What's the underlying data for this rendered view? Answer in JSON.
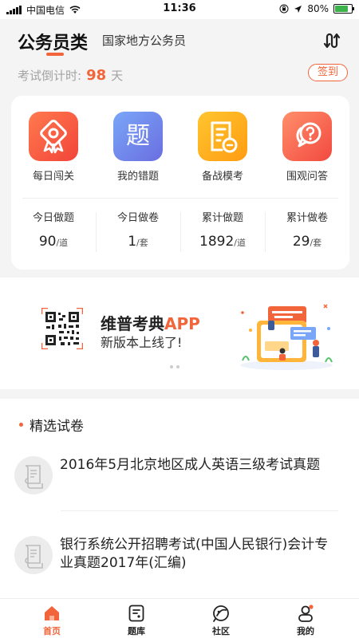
{
  "status": {
    "carrier": "中国电信",
    "time": "11:36",
    "battery": "80%",
    "battery_level": 0.8
  },
  "header": {
    "category": "公务员类",
    "subcategory": "国家地方公务员",
    "countdown_prefix": "考试倒计时:",
    "countdown_days": "98",
    "countdown_unit": "天",
    "signin_label": "签到"
  },
  "features": [
    {
      "label": "每日闯关",
      "icon": "award-icon",
      "color_from": "#ff7a4e",
      "color_to": "#f2443a"
    },
    {
      "label": "我的错题",
      "icon": "wrong-questions-icon",
      "glyph": "题",
      "color_from": "#7aa6f8",
      "color_to": "#6a6ee0"
    },
    {
      "label": "备战模考",
      "icon": "mock-exam-icon",
      "color_from": "#ffc52e",
      "color_to": "#ff9c12"
    },
    {
      "label": "围观问答",
      "icon": "qa-bubble-icon",
      "color_from": "#ff8f6b",
      "color_to": "#f2493f"
    }
  ],
  "stats": [
    {
      "label": "今日做题",
      "value": "90",
      "unit": "/道"
    },
    {
      "label": "今日做卷",
      "value": "1",
      "unit": "/套"
    },
    {
      "label": "累计做题",
      "value": "1892",
      "unit": "/道"
    },
    {
      "label": "累计做卷",
      "value": "29",
      "unit": "/套"
    }
  ],
  "banner": {
    "title": "维普考典",
    "title_accent": "APP",
    "subtitle": "新版本上线了!"
  },
  "section": {
    "title": "精选试卷",
    "papers": [
      {
        "title": "2016年5月北京地区成人英语三级考试真题"
      },
      {
        "title": "银行系统公开招聘考试(中国人民银行)会计专业真题2017年(汇编)"
      }
    ]
  },
  "tabs": [
    {
      "label": "首页",
      "icon": "home-icon",
      "active": true
    },
    {
      "label": "题库",
      "icon": "question-bank-icon",
      "active": false
    },
    {
      "label": "社区",
      "icon": "community-icon",
      "active": false
    },
    {
      "label": "我的",
      "icon": "profile-icon",
      "active": false
    }
  ],
  "colors": {
    "accent": "#f2653a",
    "background": "#f4f4f4"
  }
}
